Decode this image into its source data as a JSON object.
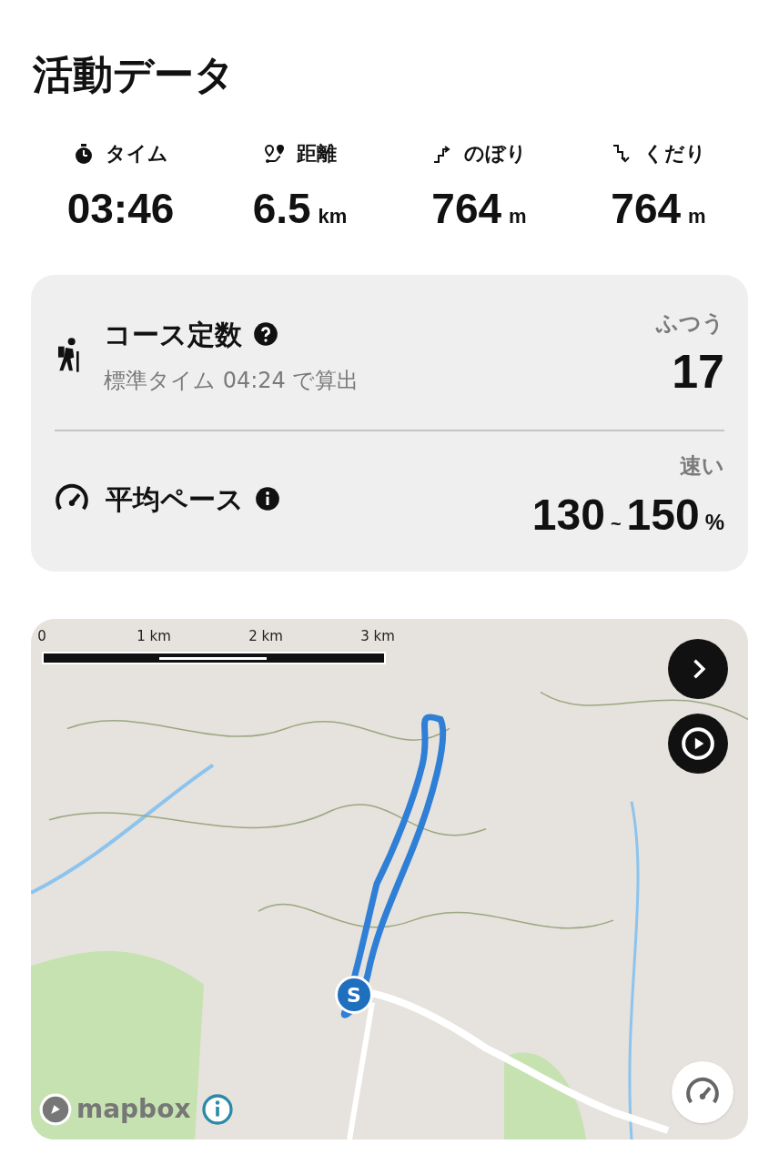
{
  "title": "活動データ",
  "stats": [
    {
      "kind": "time",
      "label": "タイム",
      "value": "03:46"
    },
    {
      "kind": "distance",
      "label": "距離",
      "value": "6.5",
      "unit": "km"
    },
    {
      "kind": "ascent",
      "label": "のぼり",
      "value": "764",
      "unit": "m"
    },
    {
      "kind": "descent",
      "label": "くだり",
      "value": "764",
      "unit": "m"
    }
  ],
  "course": {
    "title": "コース定数",
    "note": "標準タイム 04:24 で算出",
    "rating": "ふつう",
    "value": "17"
  },
  "pace": {
    "title": "平均ペース",
    "rating": "速い",
    "low": "130",
    "sep": "~",
    "high": "150",
    "unit": "%"
  },
  "map": {
    "scale_labels": [
      "0",
      "1 km",
      "2 km",
      "3 km"
    ],
    "marker": "S",
    "attribution": "mapbox"
  }
}
